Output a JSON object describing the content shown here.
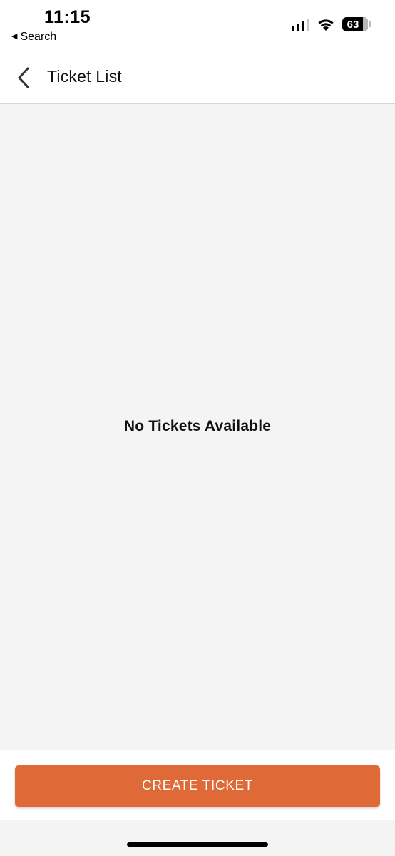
{
  "status_bar": {
    "time": "11:15",
    "back_app_label": "Search",
    "back_icon": "triangle-left-icon",
    "battery_level": "63",
    "signal_bars_active": 3,
    "signal_bars_total": 4
  },
  "header": {
    "title": "Ticket List",
    "back_icon": "chevron-left-icon"
  },
  "content": {
    "empty_message": "No Tickets Available"
  },
  "footer": {
    "create_button_label": "CREATE TICKET"
  },
  "colors": {
    "accent": "#e06a37",
    "background": "#f4f4f4",
    "surface": "#ffffff"
  }
}
